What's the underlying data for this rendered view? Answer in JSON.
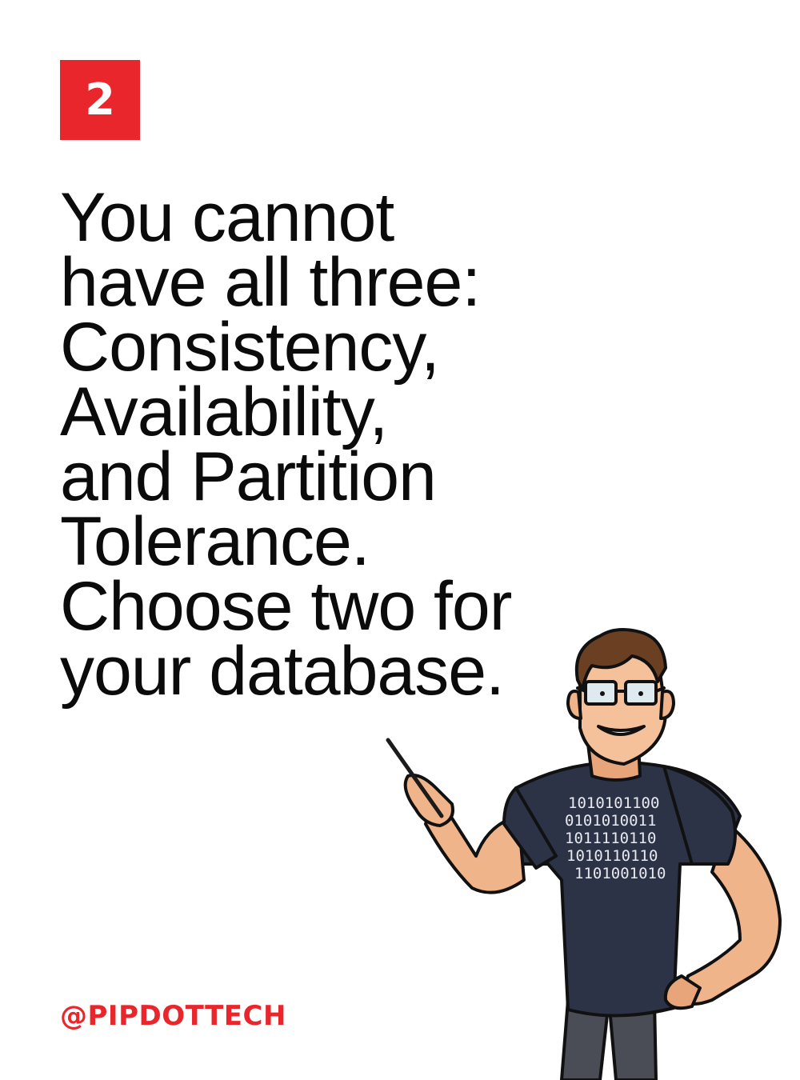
{
  "slide": {
    "number": "2",
    "accent_color": "#E8262C"
  },
  "headline": {
    "lines": [
      "You cannot",
      "have all three:",
      "Consistency,",
      "Availability,",
      "and Partition",
      "Tolerance.",
      "Choose two for",
      "your database."
    ]
  },
  "footer": {
    "handle": "@PIPDOTTECH"
  },
  "illustration": {
    "subject": "developer-character-icon",
    "shirt_text": [
      "1010101100",
      "0101010011",
      "1011110110",
      "1010110110",
      "1101001010"
    ]
  }
}
